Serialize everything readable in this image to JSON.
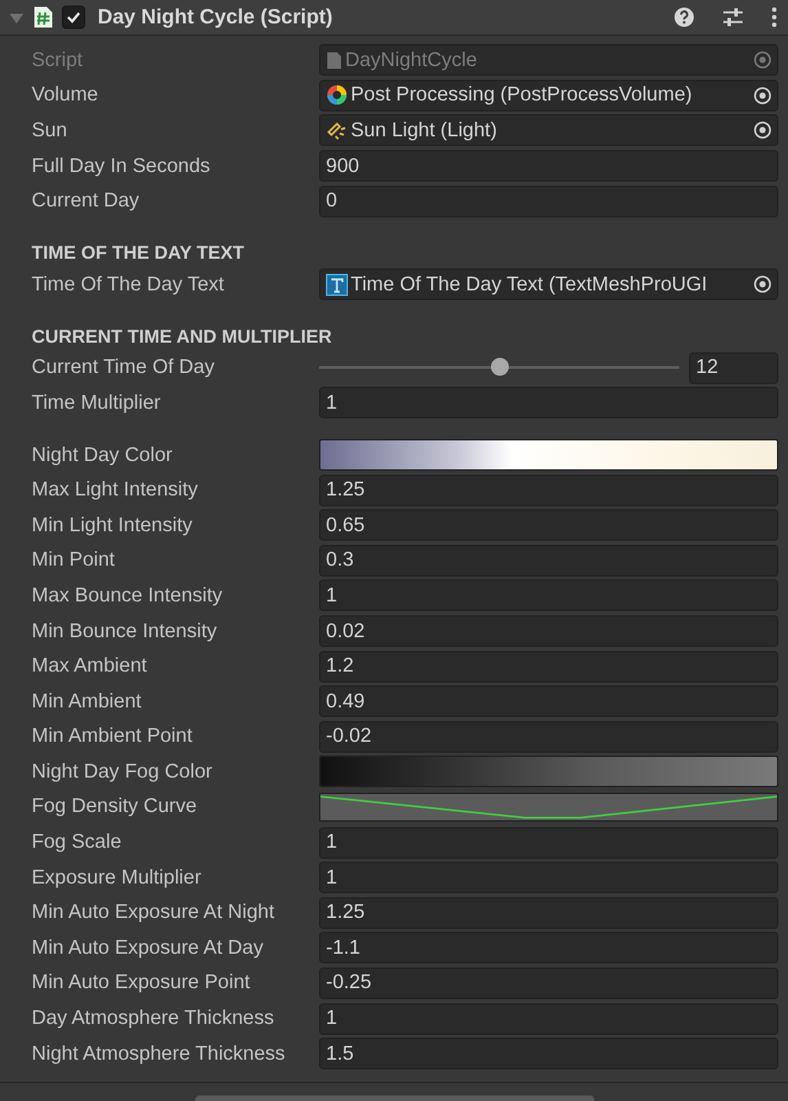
{
  "component": {
    "title": "Day Night Cycle (Script)",
    "expanded": true,
    "enabled": true
  },
  "groups": [
    {
      "fields": [
        {
          "kind": "object",
          "label": "Script",
          "value": "DayNightCycle",
          "disabled": true
        },
        {
          "kind": "object",
          "label": "Volume",
          "value": "Post Processing (PostProcessVolume)",
          "disabled": false
        },
        {
          "kind": "object",
          "label": "Sun",
          "value": "Sun Light (Light)",
          "disabled": false
        },
        {
          "kind": "number",
          "label": "Full Day In Seconds",
          "value": "900"
        },
        {
          "kind": "number",
          "label": "Current Day",
          "value": "0"
        }
      ]
    },
    {
      "heading": "TIME OF THE DAY TEXT",
      "fields": [
        {
          "kind": "object",
          "label": "Time Of The Day Text",
          "value": "Time Of The Day Text (TextMeshProUGI",
          "disabled": false
        }
      ]
    },
    {
      "heading": "CURRENT TIME AND MULTIPLIER",
      "fields": [
        {
          "kind": "slider",
          "label": "Current Time Of Day",
          "value": "12",
          "level": 0.5
        },
        {
          "kind": "number",
          "label": "Time Multiplier",
          "value": "1"
        }
      ]
    },
    {
      "fields": [
        {
          "kind": "gradient",
          "label": "Night Day Color"
        },
        {
          "kind": "number",
          "label": "Max Light Intensity",
          "value": "1.25"
        },
        {
          "kind": "number",
          "label": "Min Light Intensity",
          "value": "0.65"
        },
        {
          "kind": "number",
          "label": "Min Point",
          "value": "0.3"
        },
        {
          "kind": "number",
          "label": "Max Bounce Intensity",
          "value": "1"
        },
        {
          "kind": "number",
          "label": "Min Bounce Intensity",
          "value": "0.02"
        },
        {
          "kind": "number",
          "label": "Max Ambient",
          "value": "1.2"
        },
        {
          "kind": "number",
          "label": "Min Ambient",
          "value": "0.49"
        },
        {
          "kind": "number",
          "label": "Min Ambient Point",
          "value": "-0.02"
        },
        {
          "kind": "gradient",
          "label": "Night Day Fog Color"
        },
        {
          "kind": "curve",
          "label": "Fog Density Curve"
        },
        {
          "kind": "number",
          "label": "Fog Scale",
          "value": "1"
        },
        {
          "kind": "number",
          "label": "Exposure Multiplier",
          "value": "1"
        },
        {
          "kind": "number",
          "label": "Min Auto Exposure At Night",
          "value": "1.25"
        },
        {
          "kind": "number",
          "label": "Min Auto Exposure At Day",
          "value": "-1.1"
        },
        {
          "kind": "number",
          "label": "Min Auto Exposure Point",
          "value": "-0.25"
        },
        {
          "kind": "number",
          "label": "Day Atmosphere Thickness",
          "value": "1"
        },
        {
          "kind": "number",
          "label": "Night Atmosphere Thickness",
          "value": "1.5"
        }
      ]
    }
  ]
}
